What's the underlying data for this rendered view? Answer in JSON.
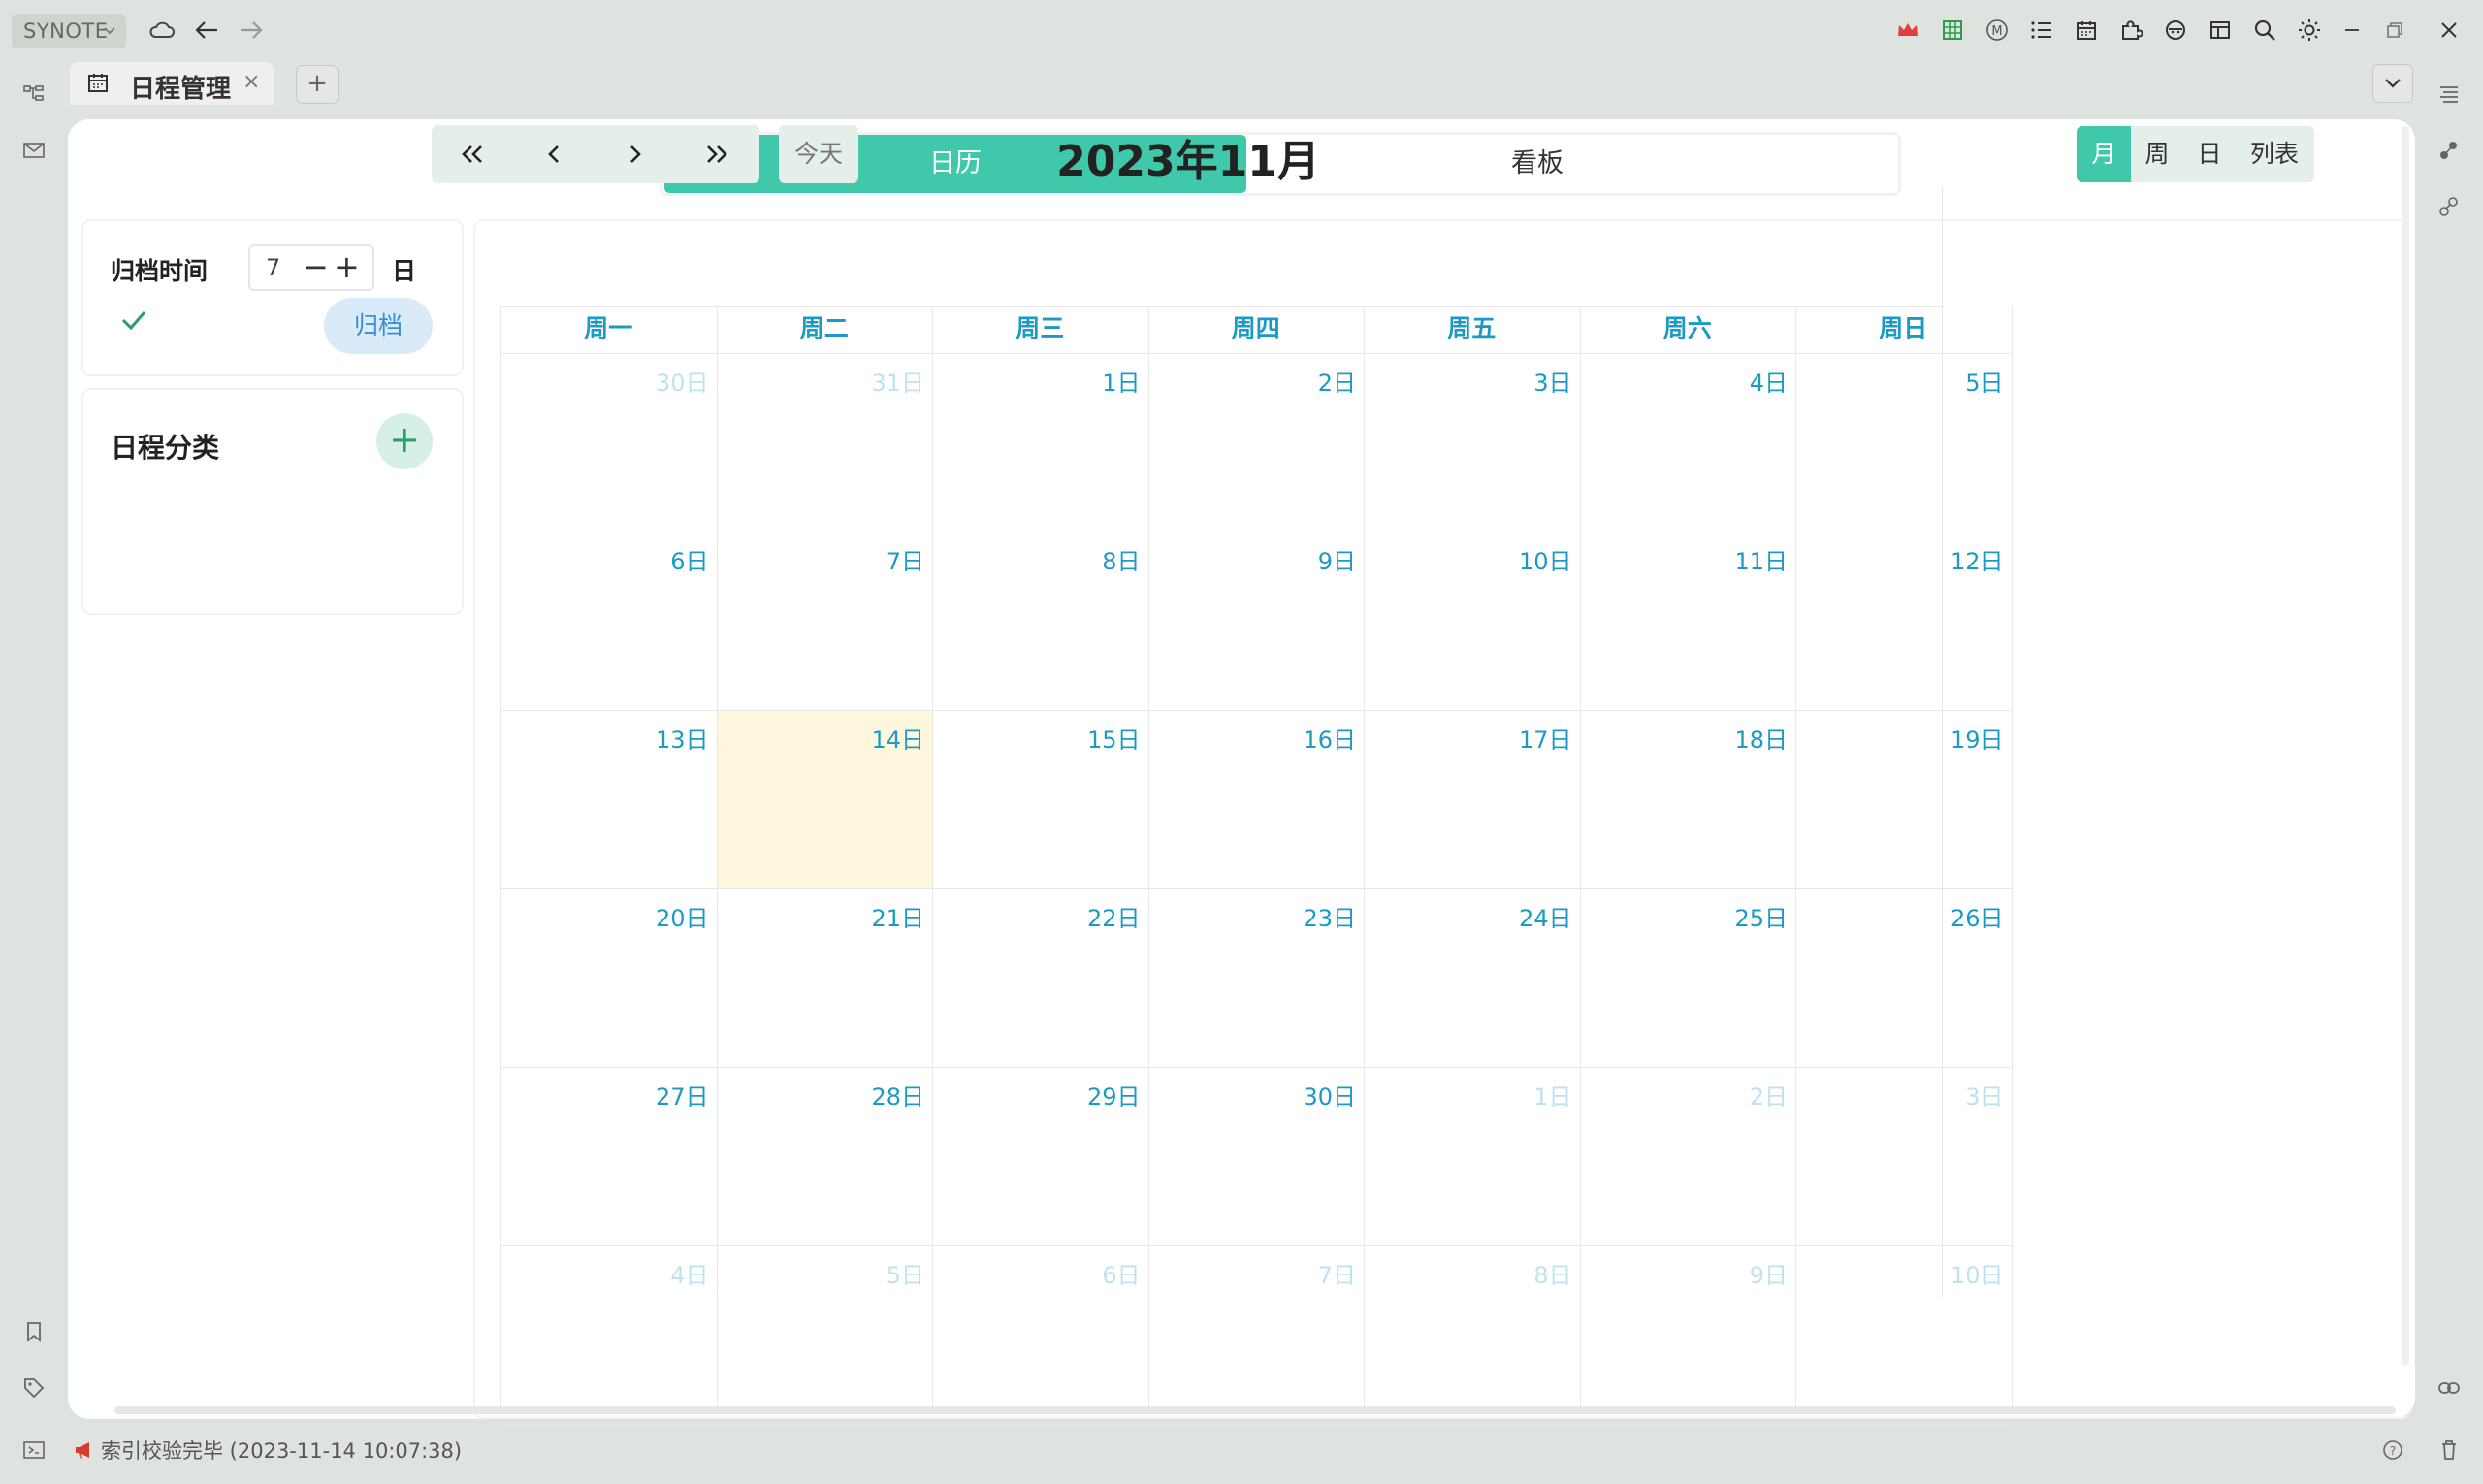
{
  "titlebar": {
    "app_name": "SYNOTE",
    "left_icons": [
      "cloud-icon",
      "back-arrow-icon",
      "forward-arrow-icon"
    ],
    "right_icons": [
      "crown-icon",
      "spreadsheet-icon",
      "markdown-m-icon",
      "list-icon",
      "calendar-icon",
      "plugin-icon",
      "face-icon",
      "layout-icon",
      "search-icon",
      "brightness-icon",
      "minimize-icon",
      "restore-icon",
      "close-icon"
    ]
  },
  "tabs": [
    {
      "label": "日程管理",
      "icon": "calendar-icon"
    }
  ],
  "main": {
    "view_switch": {
      "calendar": "日历",
      "kanban": "看板",
      "active": "calendar"
    },
    "archive_card": {
      "label": "归档时间",
      "days_value": "7",
      "unit": "日",
      "button": "归档"
    },
    "category_card": {
      "label": "日程分类"
    },
    "calendar": {
      "nav": [
        "«",
        "‹",
        "›",
        "»"
      ],
      "today": "今天",
      "title": "2023年11月",
      "views": [
        "月",
        "周",
        "日",
        "列表"
      ],
      "active_view": "月",
      "weekdays": [
        "周一",
        "周二",
        "周三",
        "周四",
        "周五",
        "周六",
        "周日"
      ],
      "weeks": [
        [
          "30日",
          "31日",
          "1日",
          "2日",
          "3日",
          "4日",
          "5日"
        ],
        [
          "6日",
          "7日",
          "8日",
          "9日",
          "10日",
          "11日",
          "12日"
        ],
        [
          "13日",
          "14日",
          "15日",
          "16日",
          "17日",
          "18日",
          "19日"
        ],
        [
          "20日",
          "21日",
          "22日",
          "23日",
          "24日",
          "25日",
          "26日"
        ],
        [
          "27日",
          "28日",
          "29日",
          "30日",
          "1日",
          "2日",
          "3日"
        ],
        [
          "4日",
          "5日",
          "6日",
          "7日",
          "8日",
          "9日",
          "10日"
        ]
      ],
      "today_label": "14日"
    }
  },
  "statusbar": {
    "text": "索引校验完毕 (2023-11-14 10:07:38)"
  },
  "colors": {
    "accent": "#40c8ab",
    "day_text": "#1b9ac4",
    "today_bg": "#fff7dd"
  }
}
